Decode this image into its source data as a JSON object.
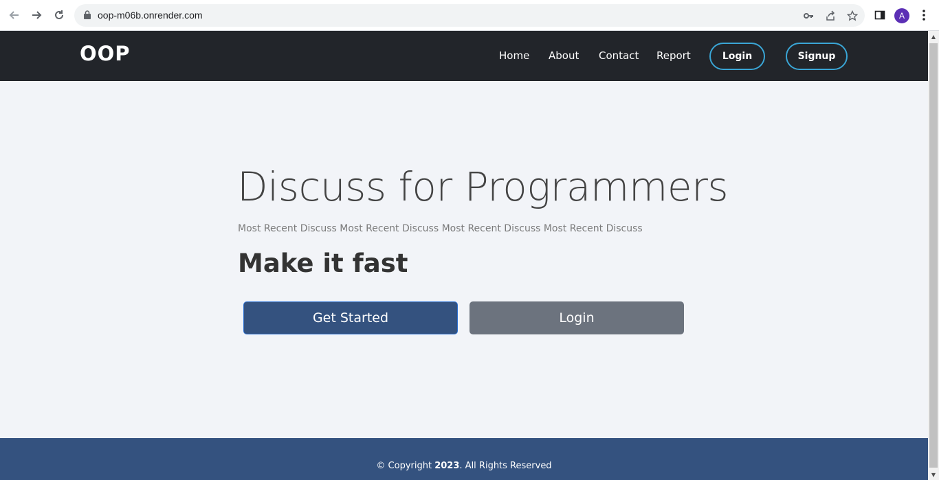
{
  "browser": {
    "url": "oop-m06b.onrender.com",
    "avatar_initial": "A"
  },
  "navbar": {
    "brand": "OOP",
    "links": [
      "Home",
      "About",
      "Contact",
      "Report"
    ],
    "login_label": "Login",
    "signup_label": "Signup"
  },
  "hero": {
    "title": "Discuss for Programmers",
    "subtitle": "Most Recent Discuss Most Recent Discuss Most Recent Discuss Most Recent Discuss",
    "tagline": "Make it fast",
    "get_started_label": "Get Started",
    "login_label": "Login"
  },
  "footer": {
    "copyright_prefix": "© Copyright ",
    "year": "2023",
    "suffix": ". All Rights Reserved"
  },
  "colors": {
    "navbar_bg": "#22252a",
    "accent_border": "#3aa6d6",
    "primary_button": "#34527f",
    "secondary_button": "#6c737e",
    "footer_bg": "#34527f",
    "page_bg": "#f2f4f8"
  }
}
